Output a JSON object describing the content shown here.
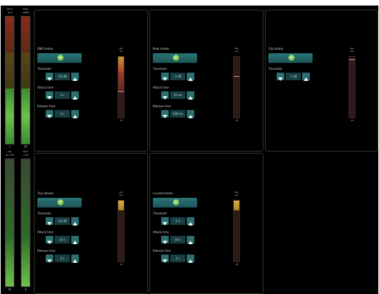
{
  "meters": {
    "top": {
      "left": {
        "head1": "Short",
        "head2": "-15,0",
        "foot": "I"
      },
      "right": {
        "head1": "Peak",
        "head2": "-3dBTP",
        "foot": "TP"
      }
    },
    "bottom": {
      "left": {
        "head1": "Avg",
        "head2": "-23 LUFS",
        "foot": "M"
      },
      "right": {
        "head1": "Peak",
        "head2": "-1 dB",
        "foot": "S"
      }
    }
  },
  "panels": [
    {
      "title": "RMS limiter",
      "threshold_label": "Threshold",
      "threshold_value": "-10 dB",
      "attack_label": "Attack time",
      "attack_value": "1 s",
      "release_label": "Release time",
      "release_value": "2 s",
      "gauge_top": "Ext",
      "gauge_sub": "-10",
      "gauge_bottom": "-40",
      "gauge_level": 0.75,
      "gauge_color": "#d1a93a"
    },
    {
      "title": "Peak limiter",
      "threshold_label": "Threshold",
      "threshold_value": "-3 dB",
      "attack_label": "Attack time",
      "attack_value": "10 ms",
      "release_label": "Release time",
      "release_value": "100 ms",
      "gauge_top": "Ext",
      "gauge_sub": "-3,0",
      "gauge_bottom": "-40",
      "gauge_level": 0.0,
      "gauge_color": "#d1a93a"
    },
    {
      "title": "Clip limiter",
      "threshold_label": "Threshold",
      "threshold_value": "-1 dB",
      "gauge_top": "Ext",
      "gauge_sub": "0,0",
      "gauge_bottom": "-40",
      "gauge_level": 0.0,
      "gauge_color": "#d1a93a"
    },
    {
      "title": "True Dreate",
      "threshold_label": "Threshold",
      "threshold_value": "-23 dB",
      "attack_label": "Attack time",
      "attack_value": "10 s",
      "release_label": "Release time",
      "release_value": "2 s",
      "gauge_top": "Ext",
      "gauge_sub": "0,0",
      "gauge_bottom": "-40",
      "gauge_level": 0.12,
      "gauge_color": "#d1a93a"
    },
    {
      "title": "Current limiter",
      "threshold_label": "Threshold",
      "threshold_value": "5 A",
      "attack_label": "Attack time",
      "attack_value": "10 s",
      "release_label": "Release time",
      "release_value": "2 s",
      "gauge_top": "Ext",
      "gauge_sub": "0,0",
      "gauge_bottom": "-40",
      "gauge_level": 0.12,
      "gauge_color": "#d1a93a"
    }
  ],
  "colors": {
    "panel_border": "#2c3a2c",
    "button": "#2d6e72",
    "meter_green": "#6fbf4d",
    "meter_red": "#c0392b"
  }
}
